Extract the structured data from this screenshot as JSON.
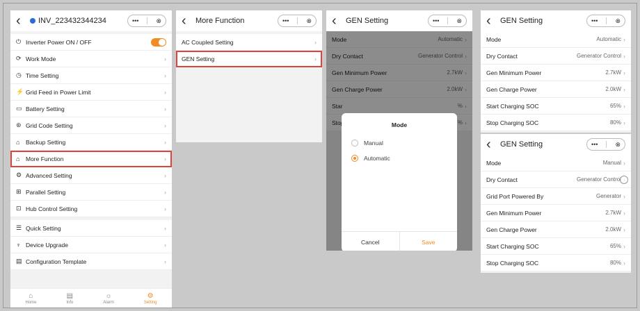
{
  "colors": {
    "accent": "#f28b24",
    "highlight": "#e0433b",
    "device_dot": "#2d6bd6"
  },
  "capsule": {
    "more": "•••",
    "close": "⊗"
  },
  "panel1": {
    "title": "INV_223432344234",
    "rows": [
      {
        "icon": "power-icon",
        "glyph": "⏻",
        "label": "Inverter Power ON / OFF"
      },
      {
        "icon": "work-mode-icon",
        "glyph": "⟳",
        "label": "Work Mode"
      },
      {
        "icon": "clock-icon",
        "glyph": "◷",
        "label": "Time Setting"
      },
      {
        "icon": "grid-tower-icon",
        "glyph": "⚡",
        "label": "Grid Feed in Power Limit"
      },
      {
        "icon": "battery-icon",
        "glyph": "▭",
        "label": "Battery Setting"
      },
      {
        "icon": "grid-code-icon",
        "glyph": "⊛",
        "label": "Grid Code Setting"
      },
      {
        "icon": "home-backup-icon",
        "glyph": "⌂",
        "label": "Backup Setting"
      },
      {
        "icon": "more-function-icon",
        "glyph": "⌂",
        "label": "More Function"
      },
      {
        "icon": "advanced-gear-icon",
        "glyph": "⚙",
        "label": "Advanced Setting"
      },
      {
        "icon": "parallel-icon",
        "glyph": "⊞",
        "label": "Parallel Setting"
      },
      {
        "icon": "hub-control-icon",
        "glyph": "⊡",
        "label": "Hub Control Setting"
      },
      {
        "icon": "quick-setting-icon",
        "glyph": "☰",
        "label": "Quick Setting"
      },
      {
        "icon": "upgrade-icon",
        "glyph": "♆",
        "label": "Device Upgrade"
      },
      {
        "icon": "template-icon",
        "glyph": "▤",
        "label": "Configuration Template"
      }
    ],
    "tabs": [
      {
        "label": "Home",
        "icon": "home-icon",
        "glyph": "⌂"
      },
      {
        "label": "Info",
        "icon": "info-icon",
        "glyph": "▤"
      },
      {
        "label": "Alarm",
        "icon": "alarm-icon",
        "glyph": "☼"
      },
      {
        "label": "Setting",
        "icon": "setting-icon",
        "glyph": "⚙"
      }
    ]
  },
  "panel2": {
    "title": "More Function",
    "rows": [
      {
        "label": "AC Coupled Setting"
      },
      {
        "label": "GEN Setting"
      }
    ]
  },
  "panel3": {
    "title": "GEN Setting",
    "rows": [
      {
        "label": "Mode",
        "value": "Automatic"
      },
      {
        "label": "Dry Contact",
        "value": "Generator Control"
      },
      {
        "label": "Gen Minimum Power",
        "value": "2.7kW"
      },
      {
        "label": "Gen Charge Power",
        "value": "2.0kW"
      },
      {
        "label": "Star",
        "value": "%"
      },
      {
        "label": "Stop",
        "value": "%"
      }
    ],
    "modal": {
      "title": "Mode",
      "options": [
        {
          "label": "Manual"
        },
        {
          "label": "Automatic"
        }
      ],
      "cancel": "Cancel",
      "save": "Save"
    }
  },
  "panel4": {
    "title": "GEN Setting",
    "rows": [
      {
        "label": "Mode",
        "value": "Automatic"
      },
      {
        "label": "Dry Contact",
        "value": "Generator Control"
      },
      {
        "label": "Gen Minimum Power",
        "value": "2.7kW"
      },
      {
        "label": "Gen Charge Power",
        "value": "2.0kW"
      },
      {
        "label": "Start Charging SOC",
        "value": "65%"
      },
      {
        "label": "Stop Charging SOC",
        "value": "80%"
      }
    ]
  },
  "panel5": {
    "title": "GEN Setting",
    "rows": [
      {
        "label": "Mode",
        "value": "Manual"
      },
      {
        "label": "Dry Contact",
        "value": "Generator Control"
      },
      {
        "label": "Grid Port Powered By",
        "value": "Generator"
      },
      {
        "label": "Gen Minimum Power",
        "value": "2.7kW"
      },
      {
        "label": "Gen Charge Power",
        "value": "2.0kW"
      },
      {
        "label": "Start Charging SOC",
        "value": "65%"
      },
      {
        "label": "Stop Charging SOC",
        "value": "80%"
      }
    ]
  }
}
